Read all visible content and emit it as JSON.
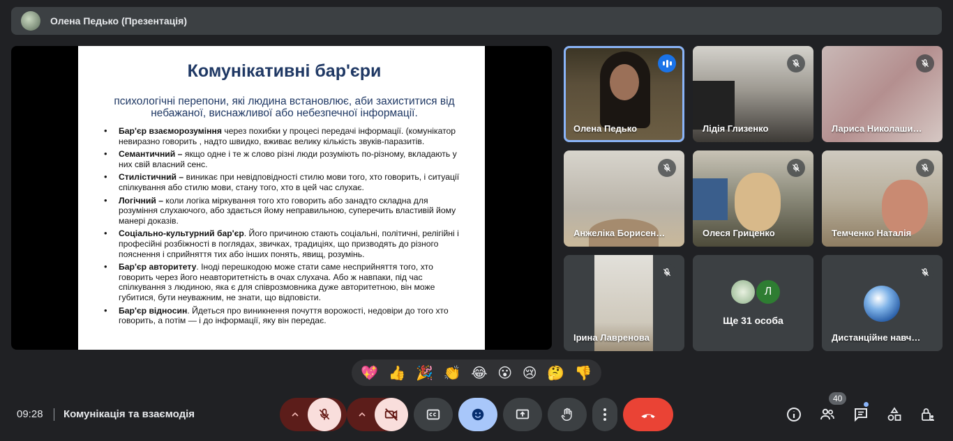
{
  "presenter": {
    "name": "Олена Педько (Презентація)"
  },
  "slide": {
    "title": "Комунікативні бар'єри",
    "subtitle": "психологічні перепони, які людина встановлює, аби захиститися від небажаної, виснажливої або небезпечної інформації.",
    "items": [
      {
        "term": "Бар'єр взаєморозуміння",
        "text": " через похибки у процесі передачі інформації. (комунікатор невиразно говорить , надто швидко, вживає велику кількість звуків-паразитів."
      },
      {
        "term": "Семантичний –",
        "text": " якщо  одне і те ж слово різні люди розуміють по-різному, вкладають у них свій власний сенс."
      },
      {
        "term": "Стилістичний –",
        "text": " виникає при невідповідності стилю мови того, хто говорить, і ситуації спілкування або стилю мови, стану того, хто в цей час слухає."
      },
      {
        "term": "Логічний –",
        "text": " коли логіка міркування того хто говорить або занадто складна для розуміння слухаючого, або здається йому неправильною, суперечить властивій йому манері доказів."
      },
      {
        "term": "Соціально-культурний бар'єр",
        "text": ". Його причиною стають соціальні, політичні, релігійні і професійні розбіжності в поглядах, звичках, традиціях, що призводять до різного пояснення і сприйняття тих або інших понять, явищ, розумінь."
      },
      {
        "term": "Бар'єр авторитету",
        "text": ". Іноді перешкодою може стати саме несприйняття того, хто говорить через його неавторитетність в очах слухача. Або ж навпаки, під час спілкування з людиною, яка є для співрозмовника дуже авторитетною, він може губитися, бути неуважним, не знати, що відповісти."
      },
      {
        "term": "Бар'єр відносин",
        "text": ". Йдеться про виникнення почуття ворожості, недовіри до того хто говорить, а потім — і до інформації, яку він передає."
      }
    ]
  },
  "participants": {
    "p1": "Олена Педько",
    "p2": "Лідія Глизенко",
    "p3": "Лариса Николаши…",
    "p4": "Анжеліка Борисен…",
    "p5": "Олеся Гриценко",
    "p6": "Темченко Наталія",
    "p7": "Ірина Лавренова",
    "more": "Ще 31 особа",
    "more_avatar_letter": "Л",
    "p9": "Дистанційне навч…"
  },
  "reactions": [
    "💖",
    "👍",
    "🎉",
    "👏",
    "😂",
    "😮",
    "😢",
    "🤔",
    "👎"
  ],
  "bottom": {
    "time": "09:28",
    "meeting_title": "Комунікація та взаємодія",
    "people_count": "40"
  },
  "colors": {
    "hangup": "#ea4335",
    "active_outline": "#8ab4f8",
    "reactions_active": "#a8c7fa"
  }
}
